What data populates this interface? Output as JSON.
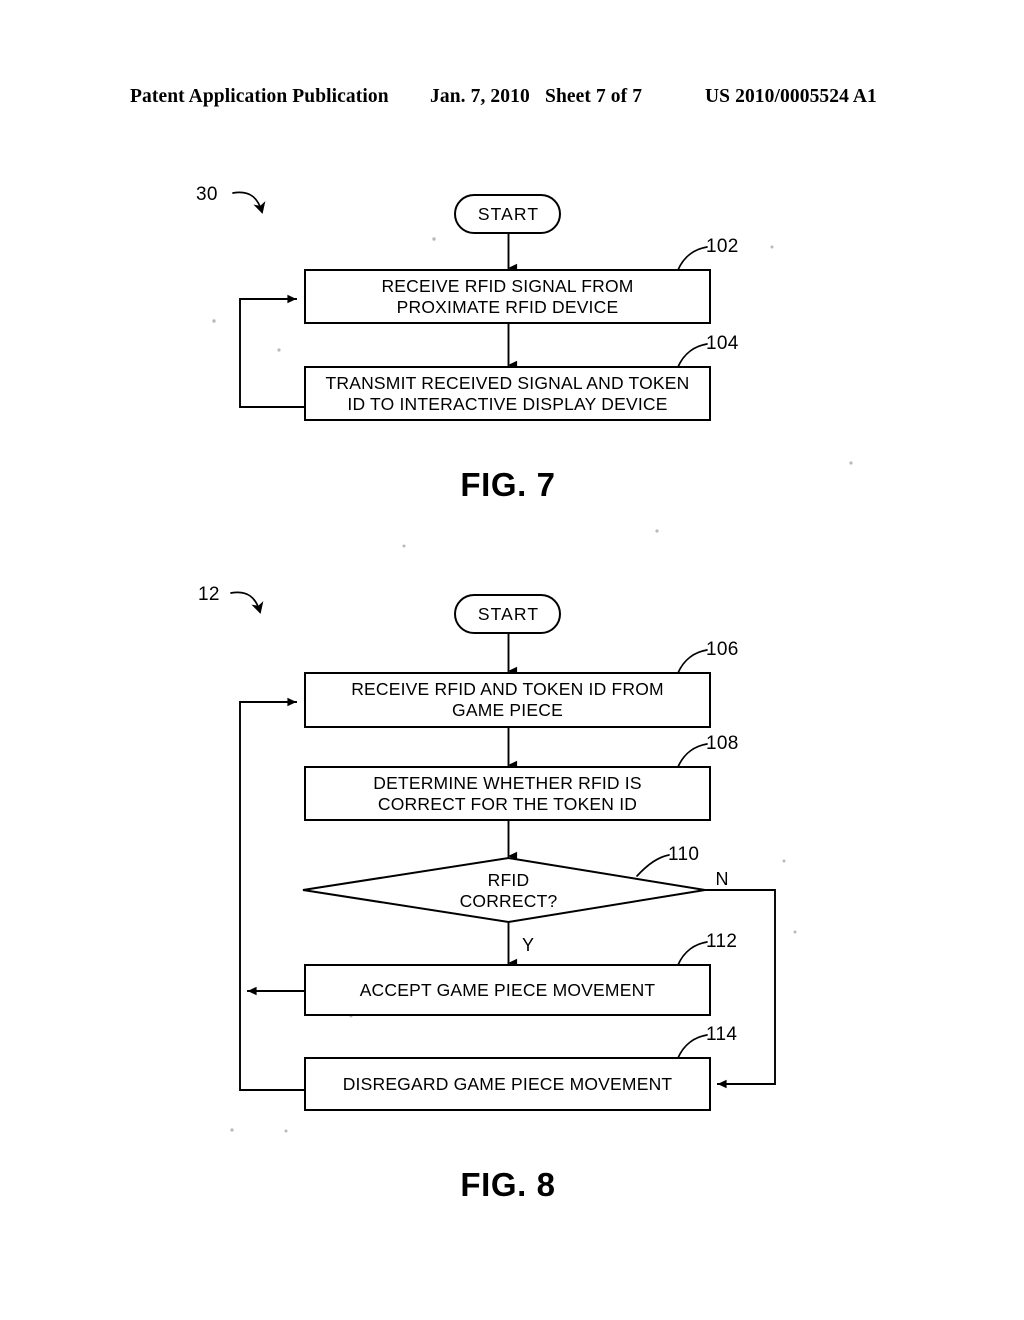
{
  "header": {
    "publication": "Patent Application Publication",
    "date": "Jan. 7, 2010",
    "sheet": "Sheet 7 of 7",
    "patent_number": "US 2010/0005524 A1"
  },
  "figures": [
    {
      "id": "fig7",
      "caption": "FIG. 7",
      "assembly_ref": "30",
      "start_label": "START",
      "nodes": [
        {
          "ref": "102",
          "type": "process",
          "lines": [
            "RECEIVE RFID SIGNAL FROM",
            "PROXIMATE RFID DEVICE"
          ]
        },
        {
          "ref": "104",
          "type": "process",
          "lines": [
            "TRANSMIT RECEIVED SIGNAL AND TOKEN",
            "ID TO INTERACTIVE DISPLAY DEVICE"
          ]
        }
      ],
      "branch_labels": []
    },
    {
      "id": "fig8",
      "caption": "FIG. 8",
      "assembly_ref": "12",
      "start_label": "START",
      "nodes": [
        {
          "ref": "106",
          "type": "process",
          "lines": [
            "RECEIVE RFID AND TOKEN ID FROM",
            "GAME PIECE"
          ]
        },
        {
          "ref": "108",
          "type": "process",
          "lines": [
            "DETERMINE WHETHER RFID IS",
            "CORRECT FOR THE TOKEN ID"
          ]
        },
        {
          "ref": "110",
          "type": "decision",
          "lines": [
            "RFID",
            "CORRECT?"
          ]
        },
        {
          "ref": "112",
          "type": "process",
          "lines": [
            "ACCEPT GAME PIECE MOVEMENT"
          ]
        },
        {
          "ref": "114",
          "type": "process",
          "lines": [
            "DISREGARD GAME PIECE MOVEMENT"
          ]
        }
      ],
      "branch_labels": [
        {
          "label": "Y",
          "meaning": "yes-branch"
        },
        {
          "label": "N",
          "meaning": "no-branch"
        }
      ]
    }
  ],
  "colors": {
    "ink": "#000000",
    "paper": "#ffffff"
  }
}
